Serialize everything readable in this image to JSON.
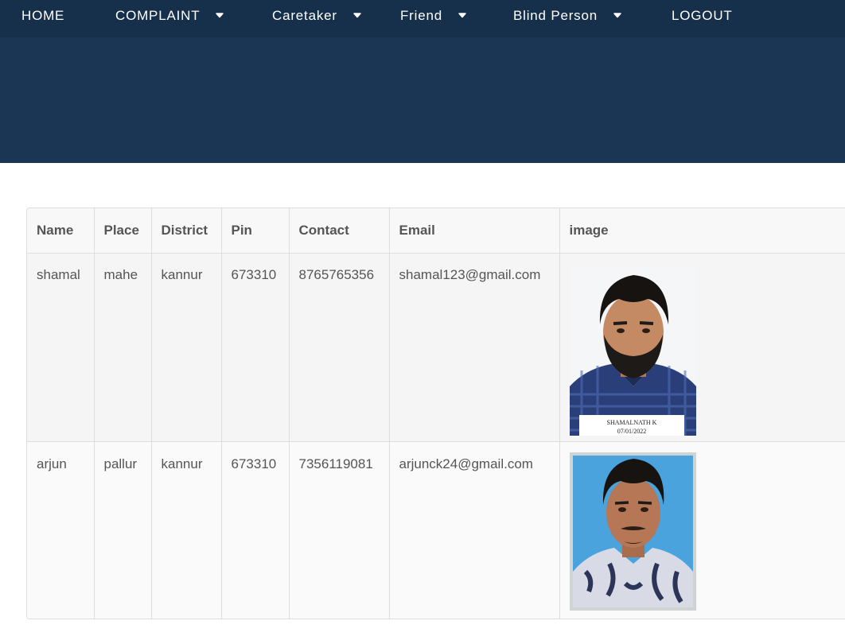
{
  "nav": {
    "home": "HOME",
    "complaint": "COMPLAINT",
    "caretaker": "Caretaker",
    "friend": "Friend",
    "blind_person": "Blind Person",
    "logout": "LOGOUT"
  },
  "colors": {
    "nav_bg": "#162f4b",
    "hero_bg": "#1b3655",
    "text": "#555555"
  },
  "table": {
    "headers": [
      "Name",
      "Place",
      "District",
      "Pin",
      "Contact",
      "Email",
      "image"
    ],
    "rows": [
      {
        "name": "shamal",
        "place": "mahe",
        "district": "kannur",
        "pin": "673310",
        "contact": "8765765356",
        "email": "shamal123@gmail.com",
        "photo_caption_name": "SHAMALNATH K",
        "photo_caption_date": "07/01/2022"
      },
      {
        "name": "arjun",
        "place": "pallur",
        "district": "kannur",
        "pin": "673310",
        "contact": "7356119081",
        "email": "arjunck24@gmail.com"
      }
    ]
  }
}
